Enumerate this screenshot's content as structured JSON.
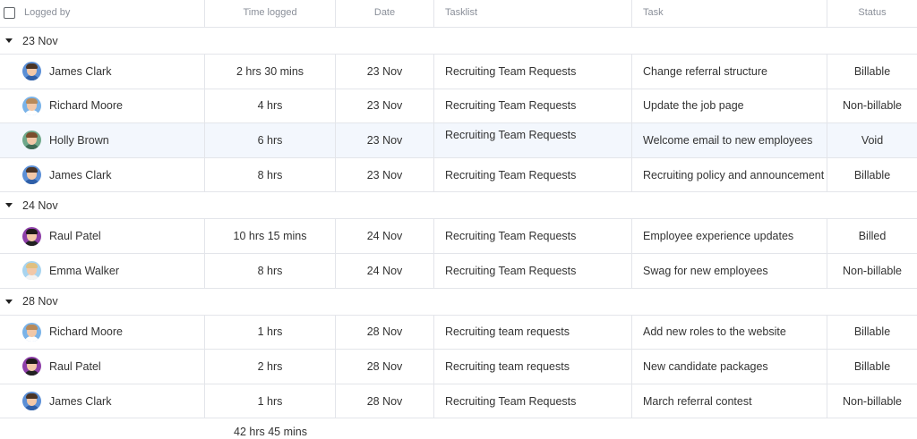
{
  "header": {
    "logged_by": "Logged by",
    "time_logged": "Time logged",
    "date": "Date",
    "tasklist": "Tasklist",
    "task": "Task",
    "status": "Status"
  },
  "groups": [
    {
      "label": "23 Nov",
      "rows": [
        {
          "name": "James Clark",
          "time": "2 hrs 30 mins",
          "date": "23 Nov",
          "tasklist": "Recruiting Team Requests",
          "task": "Change referral structure",
          "status": "Billable",
          "avatar_bg": "#5b8fd6",
          "hair": "#4a3426",
          "shirt": "#2f5fa8"
        },
        {
          "name": "Richard Moore",
          "time": "4 hrs",
          "date": "23 Nov",
          "tasklist": "Recruiting Team Requests",
          "task": "Update the job page",
          "status": "Non-billable",
          "avatar_bg": "#7ab3e8",
          "hair": "#b88a5a",
          "shirt": "#ffffff"
        },
        {
          "name": "Holly Brown",
          "time": "6 hrs",
          "date": "23 Nov",
          "tasklist": "Recruiting Team Requests",
          "task": "Welcome email to new employees",
          "status": "Void",
          "avatar_bg": "#6fa88a",
          "hair": "#7a4e2c",
          "shirt": "#3f6b55"
        },
        {
          "name": "James Clark",
          "time": "8 hrs",
          "date": "23 Nov",
          "tasklist": "Recruiting Team Requests",
          "task": "Recruiting policy and announcement",
          "status": "Billable",
          "avatar_bg": "#5b8fd6",
          "hair": "#4a3426",
          "shirt": "#2f5fa8"
        }
      ]
    },
    {
      "label": "24 Nov",
      "rows": [
        {
          "name": "Raul Patel",
          "time": "10 hrs 15 mins",
          "date": "24 Nov",
          "tasklist": "Recruiting Team Requests",
          "task": "Employee experience updates",
          "status": "Billed",
          "avatar_bg": "#8e3fa8",
          "hair": "#1f1a18",
          "shirt": "#222222"
        },
        {
          "name": "Emma Walker",
          "time": "8 hrs",
          "date": "24 Nov",
          "tasklist": "Recruiting Team Requests",
          "task": "Swag for new employees",
          "status": "Non-billable",
          "avatar_bg": "#a8d4ef",
          "hair": "#e0c080",
          "shirt": "#f3f3f3"
        }
      ]
    },
    {
      "label": "28 Nov",
      "rows": [
        {
          "name": "Richard Moore",
          "time": "1 hrs",
          "date": "28 Nov",
          "tasklist": "Recruiting team requests",
          "task": "Add new roles to the website",
          "status": "Billable",
          "avatar_bg": "#7ab3e8",
          "hair": "#b88a5a",
          "shirt": "#ffffff"
        },
        {
          "name": "Raul Patel",
          "time": "2 hrs",
          "date": "28 Nov",
          "tasklist": "Recruiting team requests",
          "task": "New candidate packages",
          "status": "Billable",
          "avatar_bg": "#8e3fa8",
          "hair": "#1f1a18",
          "shirt": "#222222"
        },
        {
          "name": "James Clark",
          "time": "1 hrs",
          "date": "28 Nov",
          "tasklist": "Recruiting Team Requests",
          "task": "March referral contest",
          "status": "Non-billable",
          "avatar_bg": "#5b8fd6",
          "hair": "#4a3426",
          "shirt": "#2f5fa8"
        }
      ]
    }
  ],
  "footer": {
    "total": "42 hrs 45 mins"
  },
  "selected_row_name": "Holly Brown"
}
